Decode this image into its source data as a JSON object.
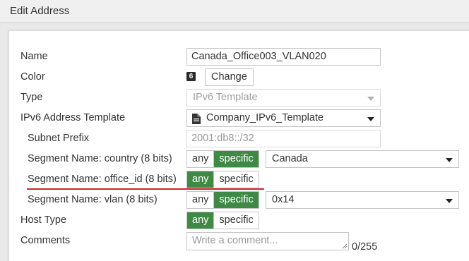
{
  "window": {
    "title": "Edit Address"
  },
  "form": {
    "name": {
      "label": "Name",
      "value": "Canada_Office003_VLAN020"
    },
    "color": {
      "label": "Color",
      "swatch": "6",
      "change_label": "Change"
    },
    "type": {
      "label": "Type",
      "value": "IPv6 Template"
    },
    "template": {
      "label": "IPv6 Address Template",
      "value": "Company_IPv6_Template",
      "icon": "file-icon"
    },
    "subnet_prefix": {
      "label": "Subnet Prefix",
      "value": "2001:db8::/32"
    },
    "segment_country": {
      "label": "Segment Name: country (8 bits)",
      "any": "any",
      "specific": "specific",
      "selected": "specific",
      "value": "Canada"
    },
    "segment_office": {
      "label": "Segment Name: office_id (8 bits)",
      "any": "any",
      "specific": "specific",
      "selected": "any"
    },
    "segment_vlan": {
      "label": "Segment Name: vlan (8 bits)",
      "any": "any",
      "specific": "specific",
      "selected": "specific",
      "value": "0x14"
    },
    "host_type": {
      "label": "Host Type",
      "any": "any",
      "specific": "specific",
      "selected": "any"
    },
    "comments": {
      "label": "Comments",
      "placeholder": "Write a comment...",
      "counter": "0/255"
    }
  },
  "colors": {
    "toggle_active": "#3e8a45",
    "highlight_underline": "#d1242a"
  }
}
